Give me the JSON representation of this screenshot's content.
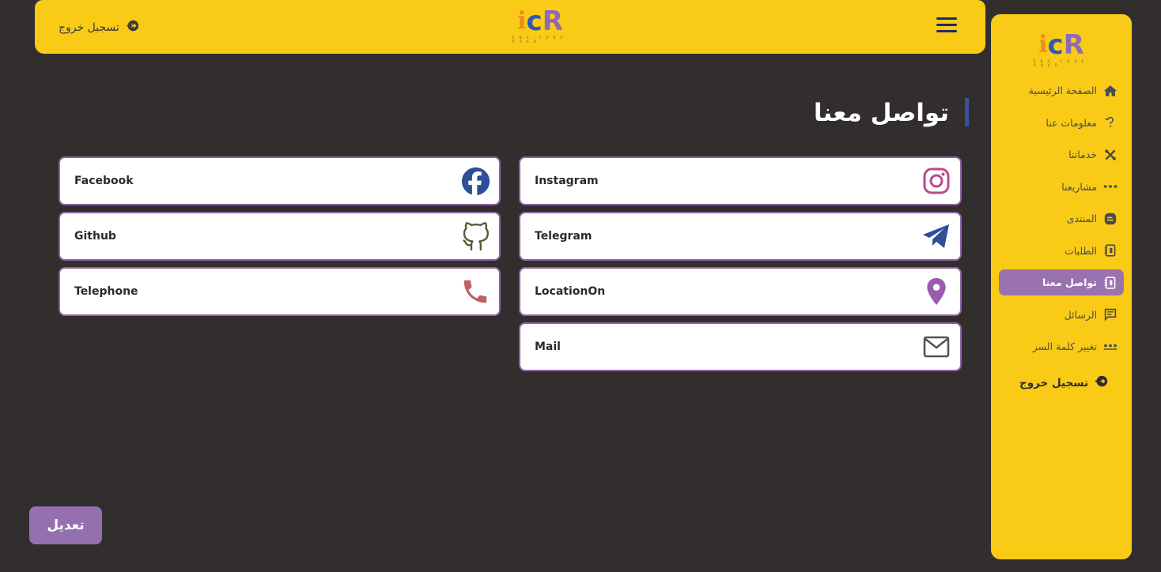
{
  "topbar": {
    "logout_label": "تسجيل خروج",
    "logo": {
      "letters": [
        "i",
        "c",
        "R"
      ],
      "tagline": "ENA CODE ROAD"
    }
  },
  "sidebar": {
    "logo": {
      "letters": [
        "i",
        "c",
        "R"
      ],
      "tagline": "ENA CODE ROAD"
    },
    "items": [
      {
        "label": "الصفحة الرئيسية",
        "icon": "home-icon",
        "active": false
      },
      {
        "label": "معلومات عنا",
        "icon": "question-icon",
        "active": false
      },
      {
        "label": "خدماتنا",
        "icon": "tools-icon",
        "active": false
      },
      {
        "label": "مشاريعنا",
        "icon": "dots-icon",
        "active": false
      },
      {
        "label": "المنتدى",
        "icon": "chat-blob-icon",
        "active": false
      },
      {
        "label": "الطلبات",
        "icon": "orders-icon",
        "active": false
      },
      {
        "label": "تواصل معنا",
        "icon": "contact-book-icon",
        "active": true
      },
      {
        "label": "الرسائل",
        "icon": "message-icon",
        "active": false
      },
      {
        "label": "تغيير كلمة السر",
        "icon": "password-dots-icon",
        "active": false
      }
    ],
    "logout_label": "تسجيل خروج"
  },
  "page": {
    "title": "تواصل معنا"
  },
  "contacts": {
    "facebook": "Facebook",
    "github": "Github",
    "telephone": "Telephone",
    "instagram": "Instagram",
    "telegram": "Telegram",
    "location": "LocationOn",
    "mail": "Mail"
  },
  "edit_button": "تعديل",
  "colors": {
    "background": "#322e2e",
    "yellow": "#f9cb17",
    "purple": "#9b72b0",
    "card_border": "#9061a8"
  }
}
